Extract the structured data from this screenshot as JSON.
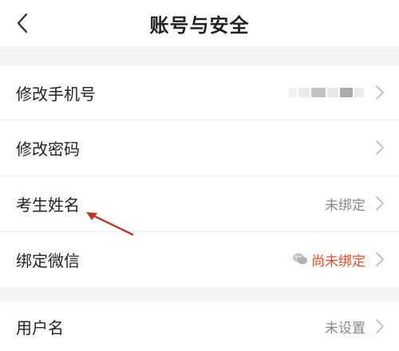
{
  "header": {
    "title": "账号与安全"
  },
  "settings": [
    {
      "label": "修改手机号",
      "value": "",
      "masked": true
    },
    {
      "label": "修改密码",
      "value": ""
    },
    {
      "label": "考生姓名",
      "value": "未绑定"
    },
    {
      "label": "绑定微信",
      "value": "尚未绑定",
      "status_color": "#e0502f",
      "icon": "wechat-icon"
    }
  ],
  "account": [
    {
      "label": "用户名",
      "value": "未设置"
    }
  ],
  "annotation": {
    "icon": "red-arrow-annotation",
    "color": "#b53a2a"
  }
}
